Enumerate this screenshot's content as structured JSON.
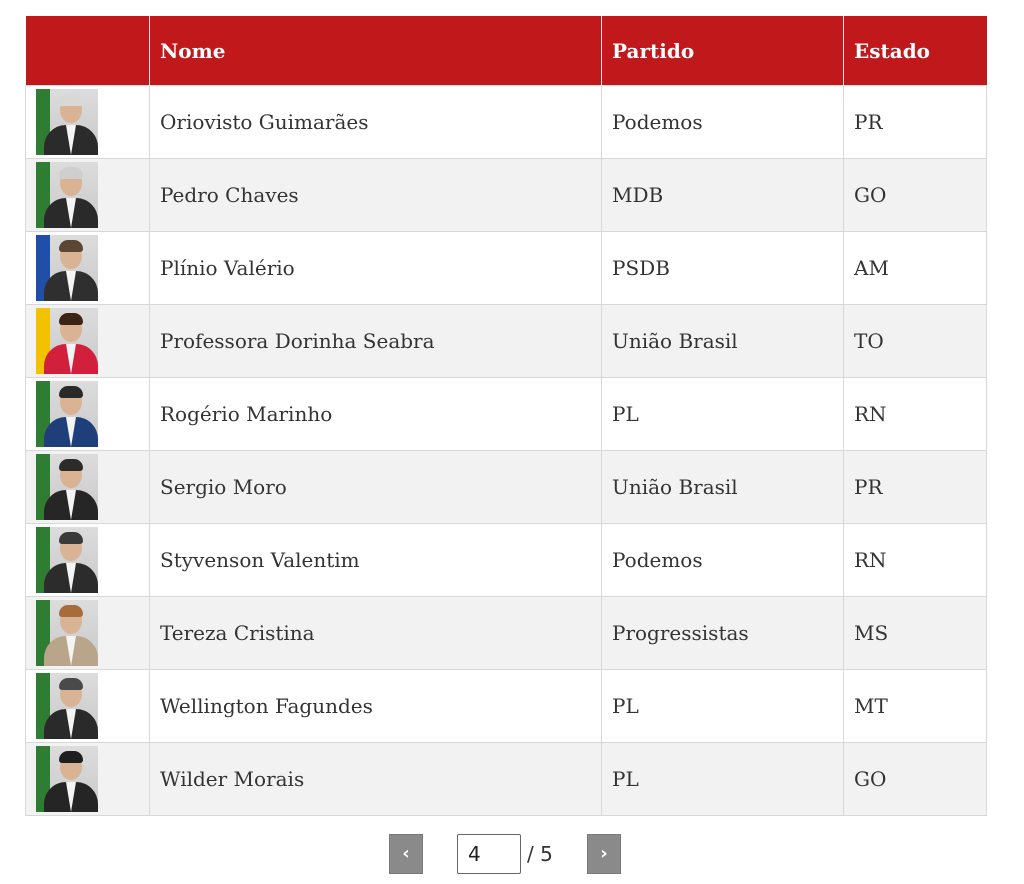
{
  "table": {
    "headers": {
      "photo": "",
      "name": "Nome",
      "party": "Partido",
      "state": "Estado"
    },
    "rows": [
      {
        "name": "Oriovisto Guimarães",
        "party": "Podemos",
        "state": "PR",
        "photo": {
          "flag": "#2e7d32",
          "suit": "#2b2b2b",
          "hair": "#d8d8d8"
        }
      },
      {
        "name": "Pedro Chaves",
        "party": "MDB",
        "state": "GO",
        "photo": {
          "flag": "#2e7d32",
          "suit": "#2a2a2a",
          "hair": "#cfcfcf"
        }
      },
      {
        "name": "Plínio Valério",
        "party": "PSDB",
        "state": "AM",
        "photo": {
          "flag": "#1f4fa8",
          "suit": "#2f2f2f",
          "hair": "#5a4632"
        }
      },
      {
        "name": "Professora Dorinha Seabra",
        "party": "União Brasil",
        "state": "TO",
        "photo": {
          "flag": "#f2c200",
          "suit": "#d21f3c",
          "hair": "#3b2416"
        }
      },
      {
        "name": "Rogério Marinho",
        "party": "PL",
        "state": "RN",
        "photo": {
          "flag": "#2e7d32",
          "suit": "#1f3f7a",
          "hair": "#2a2a2a"
        }
      },
      {
        "name": "Sergio Moro",
        "party": "União Brasil",
        "state": "PR",
        "photo": {
          "flag": "#2e7d32",
          "suit": "#262626",
          "hair": "#2b2b2b"
        }
      },
      {
        "name": "Styvenson Valentim",
        "party": "Podemos",
        "state": "RN",
        "photo": {
          "flag": "#2e7d32",
          "suit": "#2c2c2c",
          "hair": "#3a3a3a"
        }
      },
      {
        "name": "Tereza Cristina",
        "party": "Progressistas",
        "state": "MS",
        "photo": {
          "flag": "#2e7d32",
          "suit": "#b9a58a",
          "hair": "#a86b3a"
        }
      },
      {
        "name": "Wellington Fagundes",
        "party": "PL",
        "state": "MT",
        "photo": {
          "flag": "#2e7d32",
          "suit": "#2a2a2a",
          "hair": "#4a4a4a"
        }
      },
      {
        "name": "Wilder Morais",
        "party": "PL",
        "state": "GO",
        "photo": {
          "flag": "#2e7d32",
          "suit": "#252525",
          "hair": "#1e1e1e"
        }
      }
    ]
  },
  "pagination": {
    "prev_label": "‹",
    "next_label": "›",
    "current_page": "4",
    "total": "/ 5"
  },
  "colors": {
    "header_bg": "#c0181b",
    "header_text": "#ffffff",
    "row_alt": "#f2f2f2",
    "pager_button": "#8a8a8a"
  }
}
